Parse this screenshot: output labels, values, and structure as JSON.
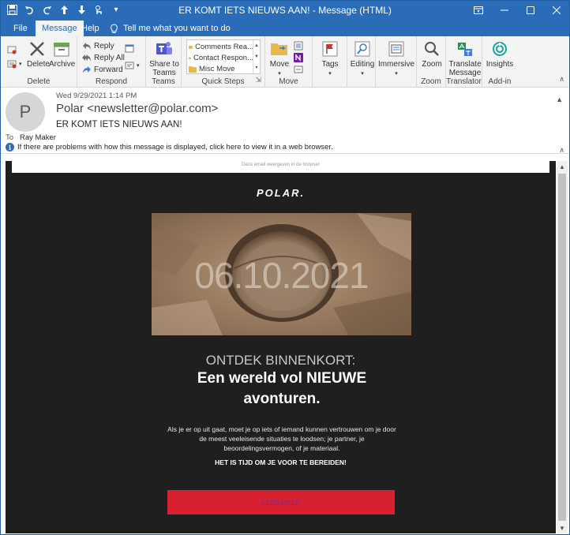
{
  "window": {
    "title": "ER KOMT IETS NIEUWS AAN!  -  Message (HTML)",
    "controls": [
      "restore-ribbon",
      "minimize",
      "maximize",
      "close"
    ]
  },
  "qat": {
    "icons": [
      "save-icon",
      "undo-icon",
      "redo-icon",
      "up-arrow-icon",
      "down-arrow-icon",
      "touch-mode-icon",
      "customize-icon"
    ]
  },
  "tabs": [
    {
      "label": "File"
    },
    {
      "label": "Message"
    },
    {
      "label": "Help"
    }
  ],
  "tell_me": "Tell me what you want to do",
  "ribbon": {
    "groups": {
      "delete": {
        "label": "Delete",
        "delete_label": "Delete",
        "archive_label": "Archive"
      },
      "respond": {
        "label": "Respond",
        "reply": "Reply",
        "reply_all": "Reply All",
        "forward": "Forward"
      },
      "teams": {
        "label": "Teams",
        "share_line1": "Share to",
        "share_line2": "Teams"
      },
      "quick_steps": {
        "label": "Quick Steps",
        "items": [
          "Comments Rea...",
          "Contact Respon...",
          "Misc Move"
        ]
      },
      "move": {
        "label": "Move",
        "move_label": "Move"
      },
      "tags": {
        "tags_label": "Tags"
      },
      "editing": {
        "editing_label": "Editing"
      },
      "immersive": {
        "immersive_label": "Immersive"
      },
      "zoom": {
        "label": "Zoom",
        "zoom_label": "Zoom"
      },
      "translator": {
        "label": "Translator",
        "line1": "Translate",
        "line2": "Message"
      },
      "addin": {
        "label": "Add-in",
        "insights_label": "Insights"
      }
    }
  },
  "message": {
    "avatar_letter": "P",
    "date": "Wed 9/29/2021 1:14 PM",
    "from": "Polar <newsletter@polar.com>",
    "subject": "ER KOMT IETS NIEUWS AAN!",
    "to_label": "To",
    "to_name": "Ray Maker",
    "info": "If there are problems with how this message is displayed, click here to view it in a web browser."
  },
  "email": {
    "webview_text": "Deze email weergeven in de browser",
    "logo": "POLAR.",
    "hero_date": "06.10.2021",
    "kicker": "ONTDEK BINNENKORT:",
    "headline": "Een wereld vol NIEUWE avonturen.",
    "body": "Als je er op uit gaat, moet je op iets of iemand kunnen vertrouwen om je door de meest veeleisende situaties te loodsen; je partner, je beoordelingsvermogen, of je materiaal.",
    "cta_text": "HET IS TIJD OM JE VOOR TE BEREIDEN!",
    "button": "LEES MEER"
  },
  "colors": {
    "accent": "#2a6cb8",
    "email_bg": "#1f1f1f",
    "cta": "#d8212f"
  }
}
